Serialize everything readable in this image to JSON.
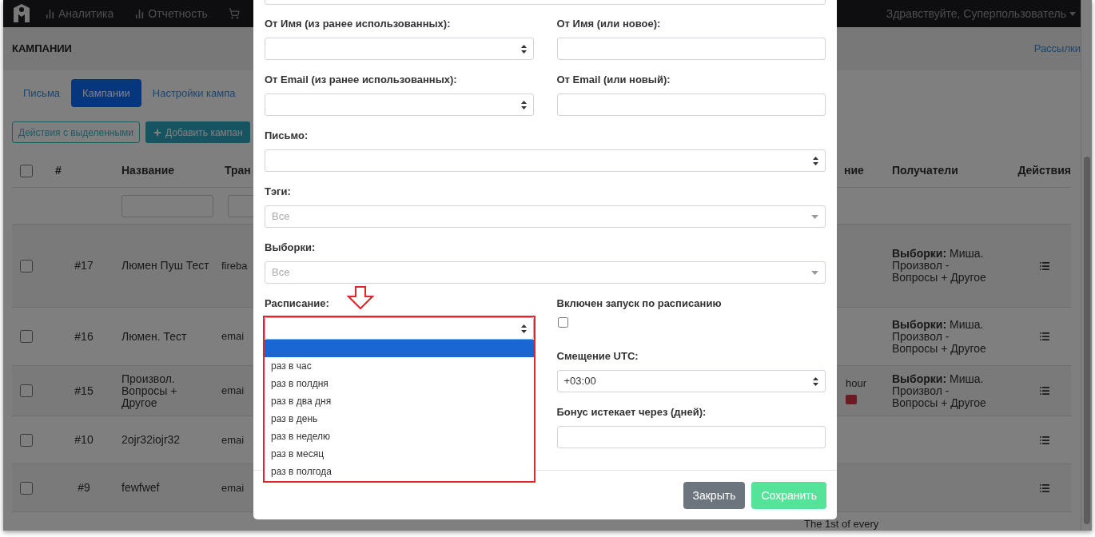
{
  "navbar": {
    "items": [
      {
        "label": "Аналитика",
        "kind": "chart"
      },
      {
        "label": "Отчетность",
        "kind": "chart"
      },
      {
        "kind": "cart"
      }
    ],
    "user_menu": "Здравствуйте, Суперпользователь"
  },
  "page_header": {
    "title": "КАМПАНИИ",
    "breadcrumb": "Рассылки"
  },
  "tabs": [
    {
      "label": "Письма",
      "selected": false
    },
    {
      "label": "Кампании",
      "selected": true
    },
    {
      "label": "Настройки кампа",
      "selected": false
    }
  ],
  "toolbar": {
    "bulk_actions": "Действия с выделенными",
    "add_button": "Добавить кампан"
  },
  "table": {
    "select_all_checked": false,
    "columns": [
      "#",
      "Название",
      "Тран",
      "ние",
      "Получатели",
      "Действия"
    ],
    "rows": [
      {
        "checked": false,
        "number": "#17",
        "name": "Люмен Пуш Тест",
        "column_3": "fireba",
        "recipients": "**Выборки:** Миша. Произвол - Вопросы + Другое"
      },
      {
        "checked": false,
        "number": "#16",
        "name": "Люмен. Тест",
        "column_3": "emai",
        "recipients": "**Выборки:** Миша. Произвол - Вопросы + Другое"
      },
      {
        "checked": false,
        "number": "#15",
        "name": "Произвол. Вопросы + Другое",
        "column_3": "emai",
        "column_4": "hour",
        "badge": true,
        "recipients": "**Выборки:** Миша. Произвол - Вопросы + Другое"
      },
      {
        "checked": false,
        "number": "#10",
        "name": "2ojr32iojr32",
        "column_3": "emai"
      },
      {
        "checked": false,
        "number": "#9",
        "name": "fewfwef",
        "column_3": "emai"
      },
      {
        "column_4": "The 1st of every"
      }
    ]
  },
  "modal": {
    "from_name_existing": {
      "label": "От Имя (из ранее использованных):"
    },
    "from_name_new": {
      "label": "От Имя (или новое):"
    },
    "from_email_existing": {
      "label": "От Email (из ранее использованных):"
    },
    "from_email_new": {
      "label": "От Email (или новый):"
    },
    "letter": {
      "label": "Письмо:"
    },
    "tags": {
      "label": "Тэги:",
      "placeholder": "Все"
    },
    "segments": {
      "label": "Выборки:",
      "placeholder": "Все"
    },
    "schedule": {
      "label": "Расписание:",
      "blank_option_highlighted": true,
      "options": [
        {
          "label": "раз в час",
          "selected": false
        },
        {
          "label": "раз в полдня",
          "selected": false
        },
        {
          "label": "раз в два дня",
          "selected": false
        },
        {
          "label": "раз в день",
          "selected": false
        },
        {
          "label": "раз в неделю",
          "selected": false
        },
        {
          "label": "раз в месяц",
          "selected": false
        },
        {
          "label": "раз в полгода",
          "selected": false
        }
      ]
    },
    "schedule_enabled": {
      "label": "Включен запуск по расписанию",
      "checked": false
    },
    "utc_offset": {
      "label": "Смещение UTC:",
      "value": "+03:00"
    },
    "bonus_expiry": {
      "label": "Бонус истекает через (дней):"
    },
    "buttons": [
      {
        "label": "Закрыть",
        "kind": "secondary"
      },
      {
        "label": "Сохранить",
        "kind": "primary"
      }
    ]
  }
}
